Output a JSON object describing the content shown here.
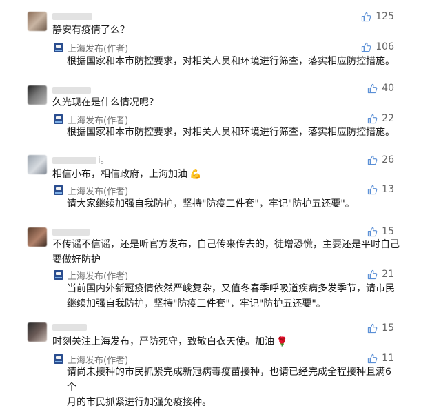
{
  "comments": [
    {
      "nick_tail": "",
      "text": "静安有疫情了么？",
      "likes": "125",
      "reply": {
        "author": "上海发布(作者)",
        "text": "根据国家和本市防控要求，对相关人员和环境进行筛查，落实相应防控措施。",
        "likes": "106"
      }
    },
    {
      "nick_tail": "",
      "text": "久光现在是什么情况呢？",
      "likes": "40",
      "reply": {
        "author": "上海发布(作者)",
        "text": "根据国家和本市防控要求，对相关人员和环境进行筛查，落实相应防控措施。",
        "likes": "22"
      }
    },
    {
      "nick_tail": "i。",
      "text": "相信小布，相信政府，上海加油",
      "emoji": "💪",
      "likes": "26",
      "reply": {
        "author": "上海发布(作者)",
        "text": "请大家继续加强自我防护，坚持\"防疫三件套\"，牢记\"防护五还要\"。",
        "likes": "13"
      }
    },
    {
      "nick_tail": "",
      "text_lines": [
        "不传谣不信谣，还是听官方发布，自己传来传去的，徒增恐慌，主要还是平时自己",
        "要做好防护"
      ],
      "likes": "15",
      "reply": {
        "author": "上海发布(作者)",
        "text_lines": [
          "当前国内外新冠疫情依然严峻复杂，又值冬春季呼吸道疾病多发季节，请市民",
          "继续加强自我防护，坚持\"防疫三件套\"，牢记\"防护五还要\"。"
        ],
        "likes": "21"
      }
    },
    {
      "nick_tail": "",
      "text": "时刻关注上海发布，严防死守，致敬白衣天使。加油",
      "emoji": "🌹",
      "likes": "15",
      "reply": {
        "author": "上海发布(作者)",
        "text_lines": [
          "请尚未接种的市民抓紧完成新冠病毒疫苗接种，也请已经完成全程接种且满6个",
          "月的市民抓紧进行加强免疫接种。"
        ],
        "likes": "11"
      }
    }
  ],
  "icons": {
    "like": "thumbs-up-icon",
    "logo": "shanghai-fabu-logo-icon"
  }
}
